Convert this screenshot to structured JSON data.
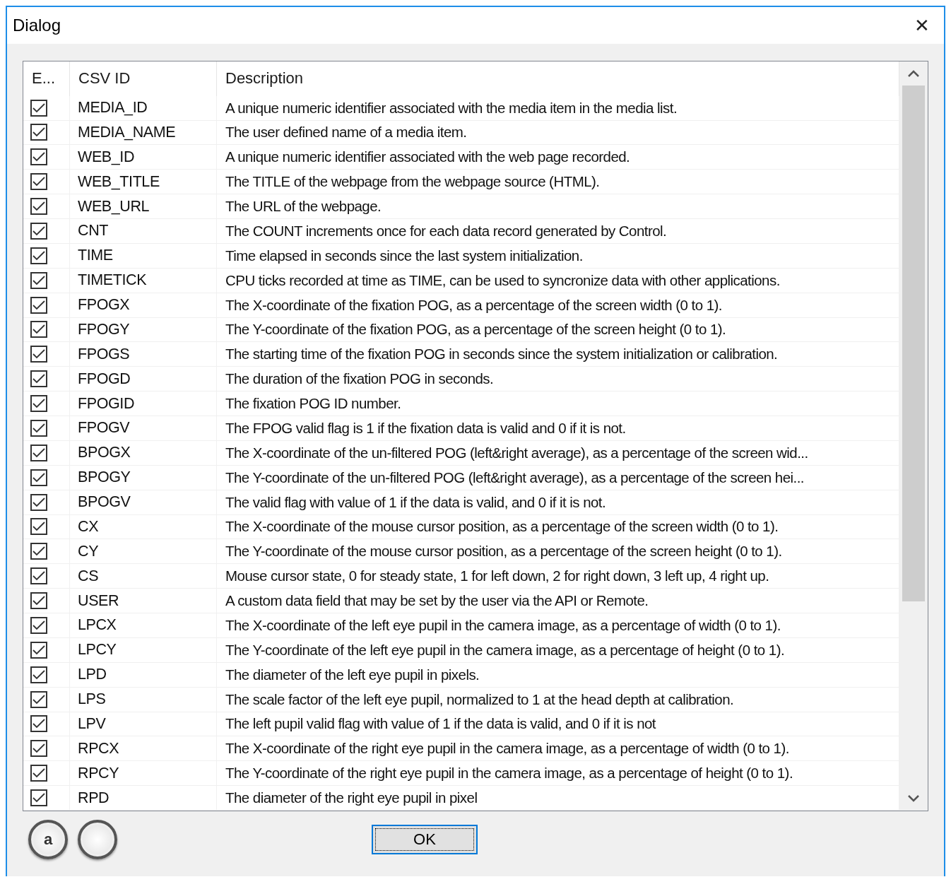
{
  "window": {
    "title": "Dialog",
    "close": "✕"
  },
  "table": {
    "columns": [
      "E...",
      "CSV ID",
      "Description"
    ],
    "rows": [
      {
        "checked": true,
        "id": "MEDIA_ID",
        "description": "A unique numeric identifier associated with the media item in the media list."
      },
      {
        "checked": true,
        "id": "MEDIA_NAME",
        "description": "The user defined name of a media item."
      },
      {
        "checked": true,
        "id": "WEB_ID",
        "description": "A unique numeric identifier associated with the web page recorded."
      },
      {
        "checked": true,
        "id": "WEB_TITLE",
        "description": "The TITLE of the webpage from the webpage source (HTML)."
      },
      {
        "checked": true,
        "id": "WEB_URL",
        "description": "The URL of the webpage."
      },
      {
        "checked": true,
        "id": "CNT",
        "description": "The COUNT increments once for each data record generated by Control."
      },
      {
        "checked": true,
        "id": "TIME",
        "description": "Time elapsed in seconds since the last system initialization."
      },
      {
        "checked": true,
        "id": "TIMETICK",
        "description": "CPU ticks recorded at time as TIME, can be used to syncronize data with other applications."
      },
      {
        "checked": true,
        "id": "FPOGX",
        "description": "The X-coordinate of the fixation POG, as a percentage of the screen width (0 to 1)."
      },
      {
        "checked": true,
        "id": "FPOGY",
        "description": "The Y-coordinate of the fixation POG, as a percentage of the screen height (0 to 1)."
      },
      {
        "checked": true,
        "id": "FPOGS",
        "description": "The starting time of the fixation POG in seconds since the system initialization or calibration."
      },
      {
        "checked": true,
        "id": "FPOGD",
        "description": "The duration of the fixation POG in seconds."
      },
      {
        "checked": true,
        "id": "FPOGID",
        "description": "The fixation POG ID number."
      },
      {
        "checked": true,
        "id": "FPOGV",
        "description": "The FPOG valid flag is 1 if the fixation data is valid and 0 if it is not."
      },
      {
        "checked": true,
        "id": "BPOGX",
        "description": "The X-coordinate of the un-filtered POG (left&right average), as a percentage of the screen wid..."
      },
      {
        "checked": true,
        "id": "BPOGY",
        "description": "The Y-coordinate of the un-filtered POG (left&right average), as a percentage of the screen hei..."
      },
      {
        "checked": true,
        "id": "BPOGV",
        "description": "The valid flag with value of 1 if the data is valid, and 0 if it is not."
      },
      {
        "checked": true,
        "id": "CX",
        "description": "The X-coordinate of the mouse cursor position, as a percentage of the screen width (0 to 1)."
      },
      {
        "checked": true,
        "id": "CY",
        "description": "The Y-coordinate of the mouse cursor position, as a percentage of the screen height (0 to 1)."
      },
      {
        "checked": true,
        "id": "CS",
        "description": "Mouse cursor state, 0 for steady state, 1 for left down, 2 for right down, 3 left up, 4 right up."
      },
      {
        "checked": true,
        "id": "USER",
        "description": "A custom data field that may be set by the user via the API or Remote."
      },
      {
        "checked": true,
        "id": "LPCX",
        "description": "The X-coordinate of the left eye pupil in the camera image, as a percentage of width (0 to 1)."
      },
      {
        "checked": true,
        "id": "LPCY",
        "description": "The Y-coordinate of the left eye pupil in the camera image, as a percentage of height (0 to 1)."
      },
      {
        "checked": true,
        "id": "LPD",
        "description": "The diameter of the left eye pupil in pixels."
      },
      {
        "checked": true,
        "id": "LPS",
        "description": "The scale factor of the left eye pupil, normalized to 1 at the head depth at calibration."
      },
      {
        "checked": true,
        "id": "LPV",
        "description": "The left pupil valid flag with value of 1 if the data is valid, and 0 if it is not"
      },
      {
        "checked": true,
        "id": "RPCX",
        "description": "The X-coordinate of the right eye pupil in the camera image, as a percentage of width (0 to 1)."
      },
      {
        "checked": true,
        "id": "RPCY",
        "description": "The Y-coordinate of the right eye pupil in the camera image, as a percentage of height (0 to 1)."
      },
      {
        "checked": true,
        "id": "RPD",
        "description": "The diameter of the right eye pupil in pixel"
      }
    ]
  },
  "footer": {
    "round_buttons": [
      {
        "kind": "lettered",
        "label": "a"
      },
      {
        "kind": "plain"
      }
    ],
    "ok": "OK"
  }
}
